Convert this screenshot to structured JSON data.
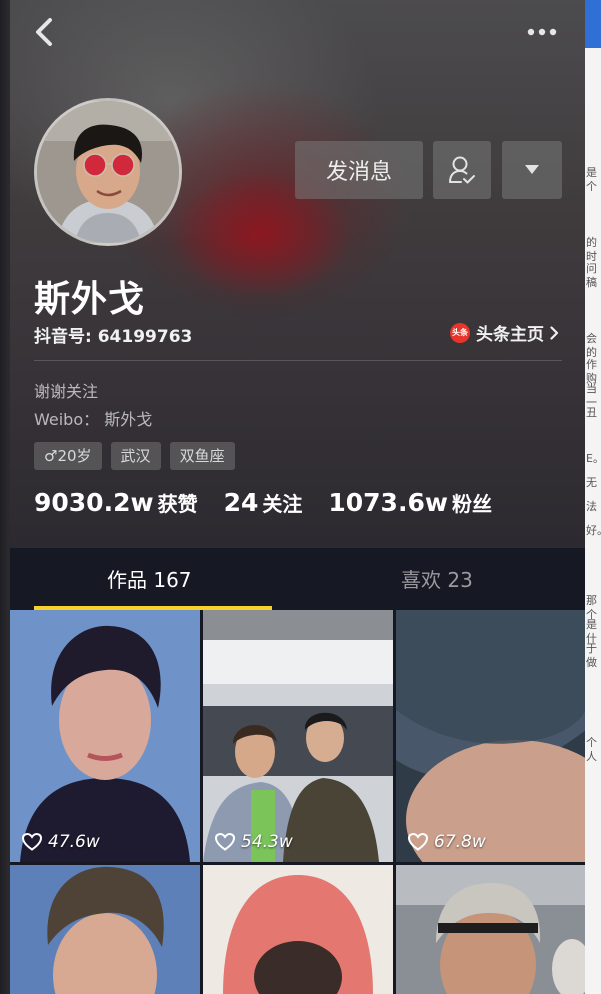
{
  "app": {
    "profile": {
      "name": "斯外戈",
      "douyin_id": "抖音号: 64199763",
      "toutiao_link": "头条主页",
      "toutiao_logo_text": "头条",
      "bio_line1": "谢谢关注",
      "bio_line2": "Weibo： 斯外戈",
      "tags": [
        "♂20岁",
        "武汉",
        "双鱼座"
      ],
      "stats": [
        {
          "num": "9030.2w",
          "label": "获赞"
        },
        {
          "num": "24",
          "label": "关注"
        },
        {
          "num": "1073.6w",
          "label": "粉丝"
        }
      ]
    },
    "buttons": {
      "message": "发消息"
    },
    "tabs": {
      "works": "作品 167",
      "likes": "喜欢 23"
    },
    "videos": [
      {
        "likes": "47.6w"
      },
      {
        "likes": "54.3w"
      },
      {
        "likes": "67.8w"
      },
      {
        "likes": ""
      },
      {
        "likes": ""
      },
      {
        "likes": ""
      }
    ],
    "colors": {
      "accent": "#f8d12e",
      "background": "#161823",
      "toutiao_red": "#e8352b"
    }
  },
  "background_page": {
    "fragments": [
      "是个",
      "的时",
      "问稿",
      "会的",
      "作购",
      "当一",
      "丑",
      "E。",
      "无",
      "法",
      "好。",
      "那个",
      "是什",
      "于做",
      "个人"
    ]
  }
}
